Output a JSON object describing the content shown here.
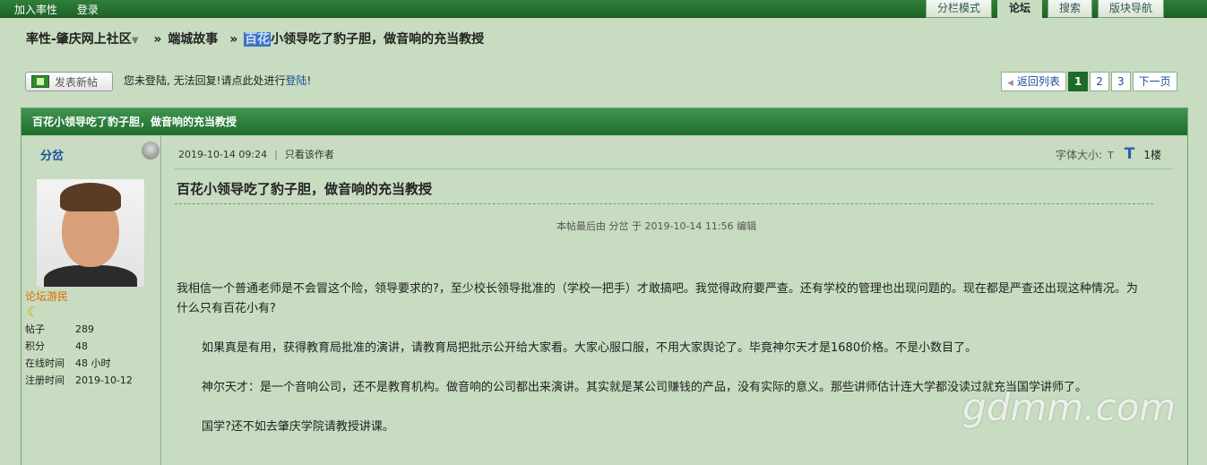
{
  "topbar": {
    "links": [
      "加入率性",
      "登录"
    ],
    "tabs": [
      "分栏模式",
      "论坛",
      "搜索",
      "版块导航"
    ],
    "active_tab": 1
  },
  "breadcrumb": {
    "site": "率性-肇庆网上社区",
    "forum": "端城故事",
    "thread_highlight": "百花",
    "thread_rest": "小领导吃了豹子胆，做音响的充当教授"
  },
  "actions": {
    "new_post": "发表新帖",
    "notice_prefix": "您未登陆, 无法回复!请点此处进行",
    "notice_link": "登陆",
    "notice_suffix": "!"
  },
  "pager": {
    "back": "返回列表",
    "pages": [
      "1",
      "2",
      "3"
    ],
    "current": "1",
    "next": "下一页"
  },
  "thread": {
    "header_title": "百花小领导吃了豹子胆，做音响的充当教授"
  },
  "author": {
    "name": "分岔",
    "rank": "论坛游民",
    "stats": [
      {
        "label": "帖子",
        "value": "289"
      },
      {
        "label": "积分",
        "value": "48"
      },
      {
        "label": "在线时间",
        "value": "48 小时"
      },
      {
        "label": "注册时间",
        "value": "2019-10-12"
      }
    ]
  },
  "post": {
    "datetime": "2019-10-14 09:24",
    "only_author": "只看该作者",
    "font_size_label": "字体大小:",
    "font_small": "T",
    "font_big": "T",
    "floor": "1楼",
    "title": "百花小领导吃了豹子胆，做音响的充当教授",
    "edited": "本帖最后由 分岔 于 2019-10-14 11:56 编辑",
    "paragraphs": [
      "我相信一个普通老师是不会冒这个险，领导要求的?，至少校长领导批准的（学校一把手）才敢搞吧。我觉得政府要严查。还有学校的管理也出现问题的。现在都是严查还出现这种情况。为什么只有百花小有?",
      "如果真是有用，获得教育局批准的演讲，请教育局把批示公开给大家看。大家心服口服，不用大家舆论了。毕竟神尔天才是1680价格。不是小数目了。",
      "神尔天才：是一个音响公司，还不是教育机构。做音响的公司都出来演讲。其实就是某公司赚钱的产品，没有实际的意义。那些讲师估计连大学都没读过就充当国学讲师了。",
      "国学?还不如去肇庆学院请教授讲课。"
    ]
  },
  "watermark": "gdmm.com"
}
